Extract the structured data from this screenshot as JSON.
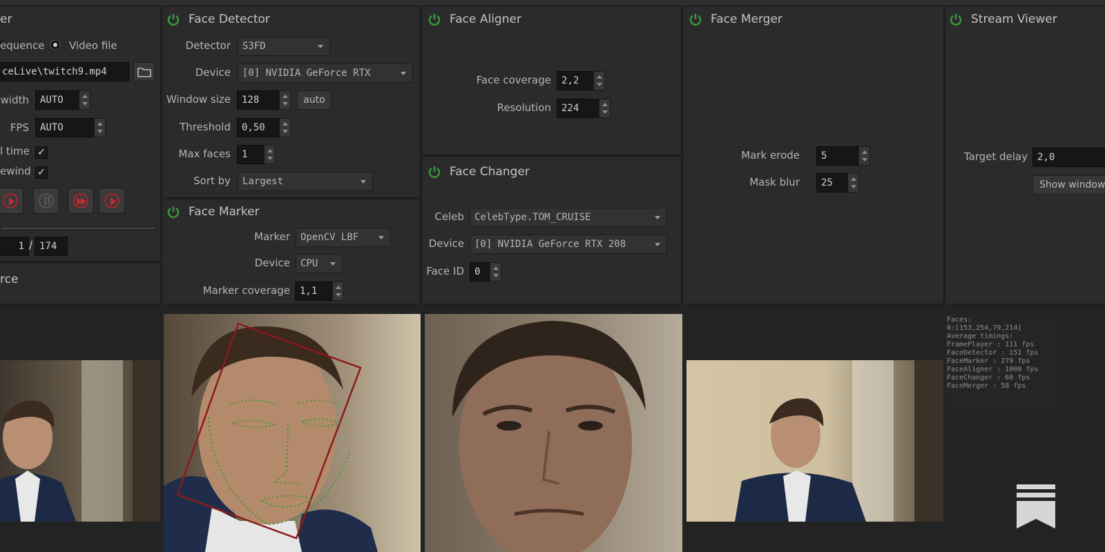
{
  "source_panel": {
    "title_fragment": "er",
    "radio_sequence": "equence",
    "radio_video": "Video file",
    "file_path": "ceLive\\twitch9.mp4",
    "width_label": "width",
    "width_value": "AUTO",
    "fps_label": "FPS",
    "fps_value": "AUTO",
    "realtime_label": "l time",
    "autorewind_label": "ewind",
    "frame_current": "1",
    "frame_separator": "/",
    "frame_total": "174",
    "next_title_fragment": "rce",
    "realtime_checked": "✓",
    "autorewind_checked": "✓"
  },
  "face_detector": {
    "title": "Face Detector",
    "detector_label": "Detector",
    "detector_value": "S3FD",
    "device_label": "Device",
    "device_value": "[0] NVIDIA GeForce RTX",
    "window_size_label": "Window size",
    "window_size_value": "128",
    "auto_button": "auto",
    "threshold_label": "Threshold",
    "threshold_value": "0,50",
    "max_faces_label": "Max faces",
    "max_faces_value": "1",
    "sort_by_label": "Sort by",
    "sort_by_value": "Largest"
  },
  "face_marker": {
    "title": "Face Marker",
    "marker_label": "Marker",
    "marker_value": "OpenCV LBF",
    "device_label": "Device",
    "device_value": "CPU",
    "coverage_label": "Marker coverage",
    "coverage_value": "1,1"
  },
  "face_aligner": {
    "title": "Face Aligner",
    "coverage_label": "Face coverage",
    "coverage_value": "2,2",
    "resolution_label": "Resolution",
    "resolution_value": "224"
  },
  "face_changer": {
    "title": "Face Changer",
    "celeb_label": "Celeb",
    "celeb_value": "CelebType.TOM_CRUISE",
    "device_label": "Device",
    "device_value": "[0] NVIDIA GeForce RTX 208",
    "face_id_label": "Face ID",
    "face_id_value": "0"
  },
  "face_merger": {
    "title": "Face Merger",
    "erode_label": "Mark erode",
    "erode_value": "5",
    "blur_label": "Mask blur",
    "blur_value": "25"
  },
  "stream_viewer": {
    "title": "Stream Viewer",
    "delay_label": "Target delay",
    "delay_value": "2,0",
    "show_window_button": "Show window"
  },
  "stats_overlay": {
    "lines": [
      "Faces:",
      "0:[153,254,79,214]",
      "Average timings:",
      "FramePlayer : 111 fps",
      "FaceDetector : 151 fps",
      "FaceMarker : 279 fps",
      "FaceAligner : 1000 fps",
      "FaceChanger : 60 fps",
      "FaceMerger : 58 fps"
    ]
  },
  "colors": {
    "power_icon": "#3a9a3a",
    "panel_bg": "#2b2b2b",
    "control_red": "#b3212a",
    "landmark_green": "#2f9a2f",
    "bbox_red": "#8a1a1a"
  }
}
